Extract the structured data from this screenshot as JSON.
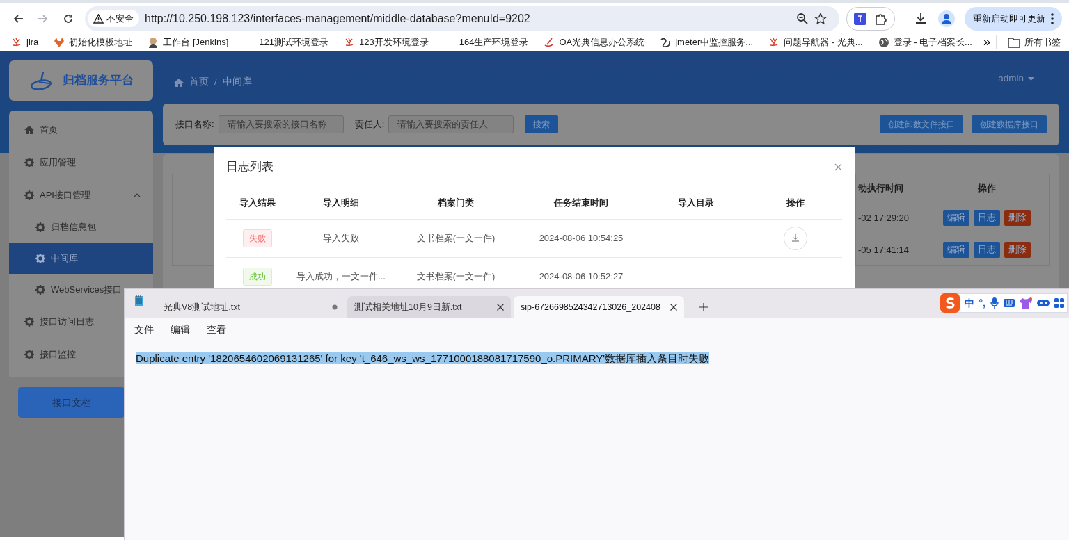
{
  "browser": {
    "nav_buttons": [
      {
        "kind": "back",
        "disabled": false
      },
      {
        "kind": "forward",
        "disabled": true
      },
      {
        "kind": "reload",
        "disabled": false
      }
    ],
    "security_label": "不安全",
    "url": "http://10.250.198.123/interfaces-management/middle-database?menuId=9202",
    "update_button": "重新启动即可更新"
  },
  "bookmarks": [
    {
      "label": "jira",
      "kind": "jira"
    },
    {
      "label": "初始化模板地址",
      "kind": "fox"
    },
    {
      "label": "工作台 [Jenkins]",
      "kind": "person"
    },
    {
      "label": "121测试环境登录",
      "kind": "none"
    },
    {
      "label": "123开发环境登录",
      "kind": "jira"
    },
    {
      "label": "164生产环境登录",
      "kind": "none"
    },
    {
      "label": "OA光典信息办公系统",
      "kind": "oa"
    },
    {
      "label": "jmeter中监控服务...",
      "kind": "jmeter"
    },
    {
      "label": "问题导航器 - 光典...",
      "kind": "jira"
    },
    {
      "label": "登录 - 电子档案长...",
      "kind": "globe"
    }
  ],
  "bookmarks_overflow": "»",
  "all_bookmarks": "所有书签",
  "app": {
    "logo_text": "归档服务平台",
    "breadcrumb": [
      "首页",
      "中间库"
    ],
    "breadcrumb_separator": "/",
    "user": "admin",
    "sidebar": {
      "items": [
        {
          "label": "首页",
          "selected": false
        },
        {
          "label": "应用管理",
          "selected": false
        },
        {
          "label": "API接口管理",
          "selected": false,
          "expanded": true,
          "children": [
            {
              "label": "归档信息包",
              "selected": false
            },
            {
              "label": "中间库",
              "selected": true
            },
            {
              "label": "WebServices接口",
              "selected": false
            }
          ]
        },
        {
          "label": "接口访问日志",
          "selected": false
        },
        {
          "label": "接口监控",
          "selected": false
        }
      ],
      "doc_button": "接口文档"
    },
    "search": {
      "fields": [
        {
          "label": "接口名称:",
          "placeholder": "请输入要搜索的接口名称"
        },
        {
          "label": "责任人:",
          "placeholder": "请输入要搜索的责任人"
        }
      ],
      "search_button": "搜索",
      "actions": [
        "创建卸数文件接口",
        "创建数据库接口"
      ]
    },
    "table": {
      "columns": [
        "动执行时间",
        "操作"
      ],
      "rows": [
        {
          "time": "-02 17:29:20",
          "actions": [
            {
              "label": "编辑",
              "kind": "edit"
            },
            {
              "label": "日志",
              "kind": "log"
            },
            {
              "label": "删除",
              "kind": "delete"
            }
          ]
        },
        {
          "time": "-05 17:41:14",
          "actions": [
            {
              "label": "编辑",
              "kind": "edit"
            },
            {
              "label": "日志",
              "kind": "log"
            },
            {
              "label": "删除",
              "kind": "delete"
            }
          ]
        }
      ]
    }
  },
  "modal": {
    "title": "日志列表",
    "columns": [
      "导入结果",
      "导入明细",
      "档案门类",
      "任务结束时间",
      "导入目录",
      "操作"
    ],
    "rows": [
      {
        "result": "失败",
        "kind": "fail",
        "detail": "导入失败",
        "category": "文书档案(一文一件)",
        "end_time": "2024-08-06 10:54:25",
        "download": true
      },
      {
        "result": "成功",
        "kind": "success",
        "detail": "导入成功，一文一件...",
        "category": "文书档案(一文一件)",
        "end_time": "2024-08-06 10:52:27",
        "download": false
      }
    ]
  },
  "editor": {
    "tabs": [
      {
        "label": "光典V8测试地址.txt",
        "selected": false,
        "modified": true
      },
      {
        "label": "测试相关地址10月9日新.txt",
        "selected": false,
        "modified": false
      },
      {
        "label": "sip-6726698524342713026_202408",
        "selected": true,
        "modified": false
      }
    ],
    "menu": [
      "文件",
      "编辑",
      "查看"
    ],
    "content": "Duplicate entry '1820654602069131265' for key 't_646_ws_ws_1771000188081717590_o.PRIMARY'数据库插入条目时失败",
    "content_selected": true,
    "ime": {
      "mode": "中",
      "punct": "°,"
    }
  }
}
